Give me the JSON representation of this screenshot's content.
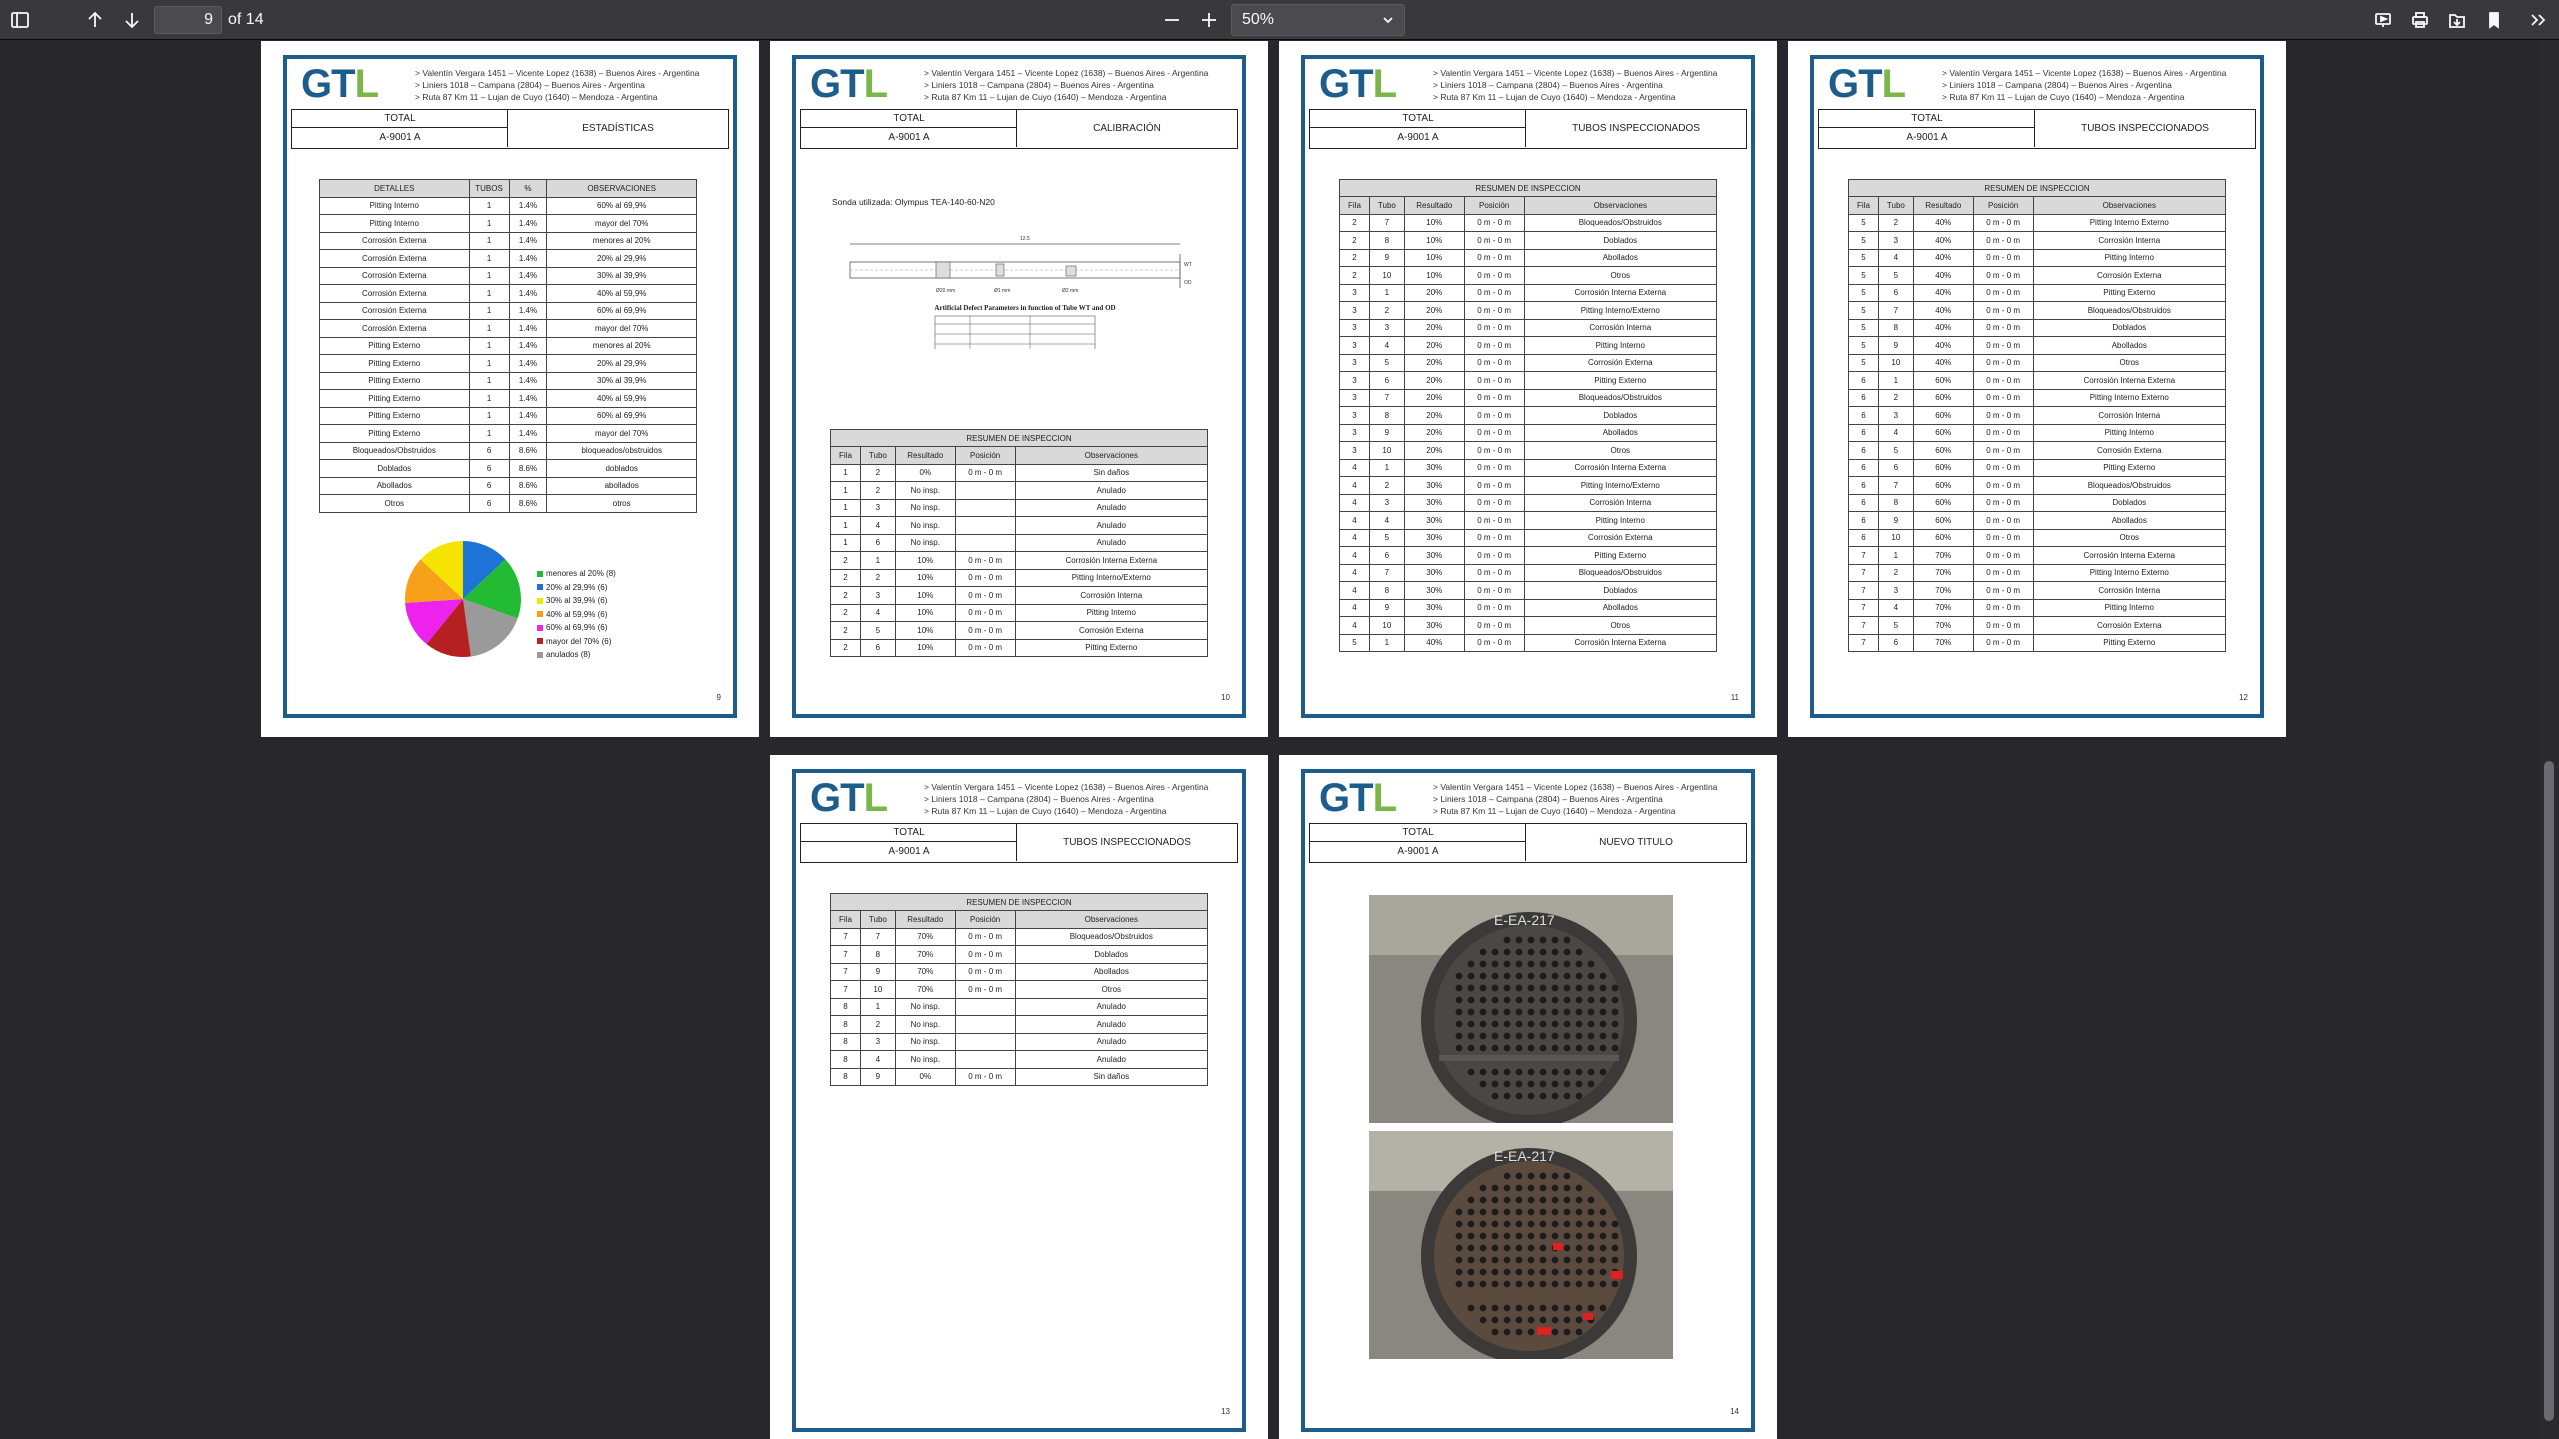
{
  "toolbar": {
    "page_current": "9",
    "page_total": "of 14",
    "zoom": "50%"
  },
  "header": {
    "logo_g": "G",
    "logo_t": "T",
    "logo_l": "L",
    "address": [
      "> Valentín Vergara 1451 – Vicente Lopez (1638) – Buenos Aires - Argentina",
      "> Liniers 1018 – Campana (2804) – Buenos Aires - Argentina",
      "> Ruta 87 Km 11 – Lujan de Cuyo (1640) – Mendoza - Argentina"
    ],
    "total_label": "TOTAL",
    "equipment": "A-9001 A"
  },
  "pages": [
    {
      "number": "9",
      "title": "ESTADÍSTICAS"
    },
    {
      "number": "10",
      "title": "CALIBRACIÓN"
    },
    {
      "number": "11",
      "title": "TUBOS INSPECCIONADOS"
    },
    {
      "number": "12",
      "title": "TUBOS INSPECCIONADOS"
    },
    {
      "number": "13",
      "title": "TUBOS INSPECCIONADOS"
    },
    {
      "number": "14",
      "title": "NUEVO TITULO"
    }
  ],
  "stats": {
    "columns": [
      "DETALLES",
      "TUBOS",
      "%",
      "OBSERVACIONES"
    ],
    "rows": [
      [
        "Pitting Interno",
        "1",
        "1.4%",
        "60% al 69,9%"
      ],
      [
        "Pitting Interno",
        "1",
        "1.4%",
        "mayor del 70%"
      ],
      [
        "Corrosión Externa",
        "1",
        "1.4%",
        "menores al 20%"
      ],
      [
        "Corrosión Externa",
        "1",
        "1.4%",
        "20% al 29,9%"
      ],
      [
        "Corrosión Externa",
        "1",
        "1.4%",
        "30% al 39,9%"
      ],
      [
        "Corrosión Externa",
        "1",
        "1.4%",
        "40% al 59,9%"
      ],
      [
        "Corrosión Externa",
        "1",
        "1.4%",
        "60% al 69,9%"
      ],
      [
        "Corrosión Externa",
        "1",
        "1.4%",
        "mayor del 70%"
      ],
      [
        "Pitting Externo",
        "1",
        "1.4%",
        "menores al 20%"
      ],
      [
        "Pitting Externo",
        "1",
        "1.4%",
        "20% al 29,9%"
      ],
      [
        "Pitting Externo",
        "1",
        "1.4%",
        "30% al 39,9%"
      ],
      [
        "Pitting Externo",
        "1",
        "1.4%",
        "40% al 59,9%"
      ],
      [
        "Pitting Externo",
        "1",
        "1.4%",
        "60% al 69,9%"
      ],
      [
        "Pitting Externo",
        "1",
        "1.4%",
        "mayor del 70%"
      ],
      [
        "Bloqueados/Obstruidos",
        "6",
        "8.6%",
        "bloqueados/obstruidos"
      ],
      [
        "Doblados",
        "6",
        "8.6%",
        "doblados"
      ],
      [
        "Abollados",
        "6",
        "8.6%",
        "abollados"
      ],
      [
        "Otros",
        "6",
        "8.6%",
        "otros"
      ]
    ]
  },
  "pie_legend": [
    {
      "label": "menores al 20% (8)",
      "color": "#22bb33"
    },
    {
      "label": "20% al 29,9% (6)",
      "color": "#1e73d6"
    },
    {
      "label": "30% al 39,9% (6)",
      "color": "#f5e400"
    },
    {
      "label": "40% al 59,9% (6)",
      "color": "#f7a11a"
    },
    {
      "label": "60% al 69,9% (6)",
      "color": "#ee22ee"
    },
    {
      "label": "mayor del 70% (6)",
      "color": "#b52020"
    },
    {
      "label": "anulados (8)",
      "color": "#9a9a9a"
    }
  ],
  "calibration": {
    "probe": "Sonda utilizada: Olympus TEA-140-60-N20",
    "diagram_caption": "Artificial Defect Parameters in function of Tube WT and OD",
    "diagram_labels": [
      "Ø20 mm",
      "Ø1 mm",
      "Ø2 mm",
      "12.5",
      "WT",
      "OD"
    ]
  },
  "summary": {
    "caption": "RESUMEN DE INSPECCION",
    "columns": [
      "Fila",
      "Tubo",
      "Resultado",
      "Posición",
      "Observaciones"
    ],
    "page10": [
      [
        "1",
        "2",
        "0%",
        "0 m - 0 m",
        "Sin daños"
      ],
      [
        "1",
        "2",
        "No insp.",
        "",
        "Anulado"
      ],
      [
        "1",
        "3",
        "No insp.",
        "",
        "Anulado"
      ],
      [
        "1",
        "4",
        "No insp.",
        "",
        "Anulado"
      ],
      [
        "1",
        "6",
        "No insp.",
        "",
        "Anulado"
      ],
      [
        "2",
        "1",
        "10%",
        "0 m - 0 m",
        "Corrosión Interna Externa"
      ],
      [
        "2",
        "2",
        "10%",
        "0 m - 0 m",
        "Pitting Interno/Externo"
      ],
      [
        "2",
        "3",
        "10%",
        "0 m - 0 m",
        "Corrosión Interna"
      ],
      [
        "2",
        "4",
        "10%",
        "0 m - 0 m",
        "Pitting Interno"
      ],
      [
        "2",
        "5",
        "10%",
        "0 m - 0 m",
        "Corrosión Externa"
      ],
      [
        "2",
        "6",
        "10%",
        "0 m - 0 m",
        "Pitting Externo"
      ]
    ],
    "page11": [
      [
        "2",
        "7",
        "10%",
        "0 m - 0 m",
        "Bloqueados/Obstruidos"
      ],
      [
        "2",
        "8",
        "10%",
        "0 m - 0 m",
        "Doblados"
      ],
      [
        "2",
        "9",
        "10%",
        "0 m - 0 m",
        "Abollados"
      ],
      [
        "2",
        "10",
        "10%",
        "0 m - 0 m",
        "Otros"
      ],
      [
        "3",
        "1",
        "20%",
        "0 m - 0 m",
        "Corrosión Interna Externa"
      ],
      [
        "3",
        "2",
        "20%",
        "0 m - 0 m",
        "Pitting Interno/Externo"
      ],
      [
        "3",
        "3",
        "20%",
        "0 m - 0 m",
        "Corrosión Interna"
      ],
      [
        "3",
        "4",
        "20%",
        "0 m - 0 m",
        "Pitting Interno"
      ],
      [
        "3",
        "5",
        "20%",
        "0 m - 0 m",
        "Corrosión Externa"
      ],
      [
        "3",
        "6",
        "20%",
        "0 m - 0 m",
        "Pitting Externo"
      ],
      [
        "3",
        "7",
        "20%",
        "0 m - 0 m",
        "Bloqueados/Obstruidos"
      ],
      [
        "3",
        "8",
        "20%",
        "0 m - 0 m",
        "Doblados"
      ],
      [
        "3",
        "9",
        "20%",
        "0 m - 0 m",
        "Abollados"
      ],
      [
        "3",
        "10",
        "20%",
        "0 m - 0 m",
        "Otros"
      ],
      [
        "4",
        "1",
        "30%",
        "0 m - 0 m",
        "Corrosión Interna Externa"
      ],
      [
        "4",
        "2",
        "30%",
        "0 m - 0 m",
        "Pitting Interno/Externo"
      ],
      [
        "4",
        "3",
        "30%",
        "0 m - 0 m",
        "Corrosión Interna"
      ],
      [
        "4",
        "4",
        "30%",
        "0 m - 0 m",
        "Pitting Interno"
      ],
      [
        "4",
        "5",
        "30%",
        "0 m - 0 m",
        "Corrosión Externa"
      ],
      [
        "4",
        "6",
        "30%",
        "0 m - 0 m",
        "Pitting Externo"
      ],
      [
        "4",
        "7",
        "30%",
        "0 m - 0 m",
        "Bloqueados/Obstruidos"
      ],
      [
        "4",
        "8",
        "30%",
        "0 m - 0 m",
        "Doblados"
      ],
      [
        "4",
        "9",
        "30%",
        "0 m - 0 m",
        "Abollados"
      ],
      [
        "4",
        "10",
        "30%",
        "0 m - 0 m",
        "Otros"
      ],
      [
        "5",
        "1",
        "40%",
        "0 m - 0 m",
        "Corrosión Interna Externa"
      ]
    ],
    "page12": [
      [
        "5",
        "2",
        "40%",
        "0 m - 0 m",
        "Pitting Interno Externo"
      ],
      [
        "5",
        "3",
        "40%",
        "0 m - 0 m",
        "Corrosión Interna"
      ],
      [
        "5",
        "4",
        "40%",
        "0 m - 0 m",
        "Pitting Interno"
      ],
      [
        "5",
        "5",
        "40%",
        "0 m - 0 m",
        "Corrosión Externa"
      ],
      [
        "5",
        "6",
        "40%",
        "0 m - 0 m",
        "Pitting Externo"
      ],
      [
        "5",
        "7",
        "40%",
        "0 m - 0 m",
        "Bloqueados/Obstruidos"
      ],
      [
        "5",
        "8",
        "40%",
        "0 m - 0 m",
        "Doblados"
      ],
      [
        "5",
        "9",
        "40%",
        "0 m - 0 m",
        "Abollados"
      ],
      [
        "5",
        "10",
        "40%",
        "0 m - 0 m",
        "Otros"
      ],
      [
        "6",
        "1",
        "60%",
        "0 m - 0 m",
        "Corrosión Interna Externa"
      ],
      [
        "6",
        "2",
        "60%",
        "0 m - 0 m",
        "Pitting Interno Externo"
      ],
      [
        "6",
        "3",
        "60%",
        "0 m - 0 m",
        "Corrosión Interna"
      ],
      [
        "6",
        "4",
        "60%",
        "0 m - 0 m",
        "Pitting Interno"
      ],
      [
        "6",
        "5",
        "60%",
        "0 m - 0 m",
        "Corrosión Externa"
      ],
      [
        "6",
        "6",
        "60%",
        "0 m - 0 m",
        "Pitting Externo"
      ],
      [
        "6",
        "7",
        "60%",
        "0 m - 0 m",
        "Bloqueados/Obstruidos"
      ],
      [
        "6",
        "8",
        "60%",
        "0 m - 0 m",
        "Doblados"
      ],
      [
        "6",
        "9",
        "60%",
        "0 m - 0 m",
        "Abollados"
      ],
      [
        "6",
        "10",
        "60%",
        "0 m - 0 m",
        "Otros"
      ],
      [
        "7",
        "1",
        "70%",
        "0 m - 0 m",
        "Corrosión Interna Externa"
      ],
      [
        "7",
        "2",
        "70%",
        "0 m - 0 m",
        "Pitting Interno Externo"
      ],
      [
        "7",
        "3",
        "70%",
        "0 m - 0 m",
        "Corrosión Interna"
      ],
      [
        "7",
        "4",
        "70%",
        "0 m - 0 m",
        "Pitting Interno"
      ],
      [
        "7",
        "5",
        "70%",
        "0 m - 0 m",
        "Corrosión Externa"
      ],
      [
        "7",
        "6",
        "70%",
        "0 m - 0 m",
        "Pitting Externo"
      ]
    ],
    "page13": [
      [
        "7",
        "7",
        "70%",
        "0 m - 0 m",
        "Bloqueados/Obstruidos"
      ],
      [
        "7",
        "8",
        "70%",
        "0 m - 0 m",
        "Doblados"
      ],
      [
        "7",
        "9",
        "70%",
        "0 m - 0 m",
        "Abollados"
      ],
      [
        "7",
        "10",
        "70%",
        "0 m - 0 m",
        "Otros"
      ],
      [
        "8",
        "1",
        "No insp.",
        "",
        "Anulado"
      ],
      [
        "8",
        "2",
        "No insp.",
        "",
        "Anulado"
      ],
      [
        "8",
        "3",
        "No insp.",
        "",
        "Anulado"
      ],
      [
        "8",
        "4",
        "No insp.",
        "",
        "Anulado"
      ],
      [
        "8",
        "9",
        "0%",
        "0 m - 0 m",
        "Sin daños"
      ]
    ]
  },
  "photos": {
    "tag_top": "E-EA-217",
    "tag_bottom": "E-EA-217"
  }
}
